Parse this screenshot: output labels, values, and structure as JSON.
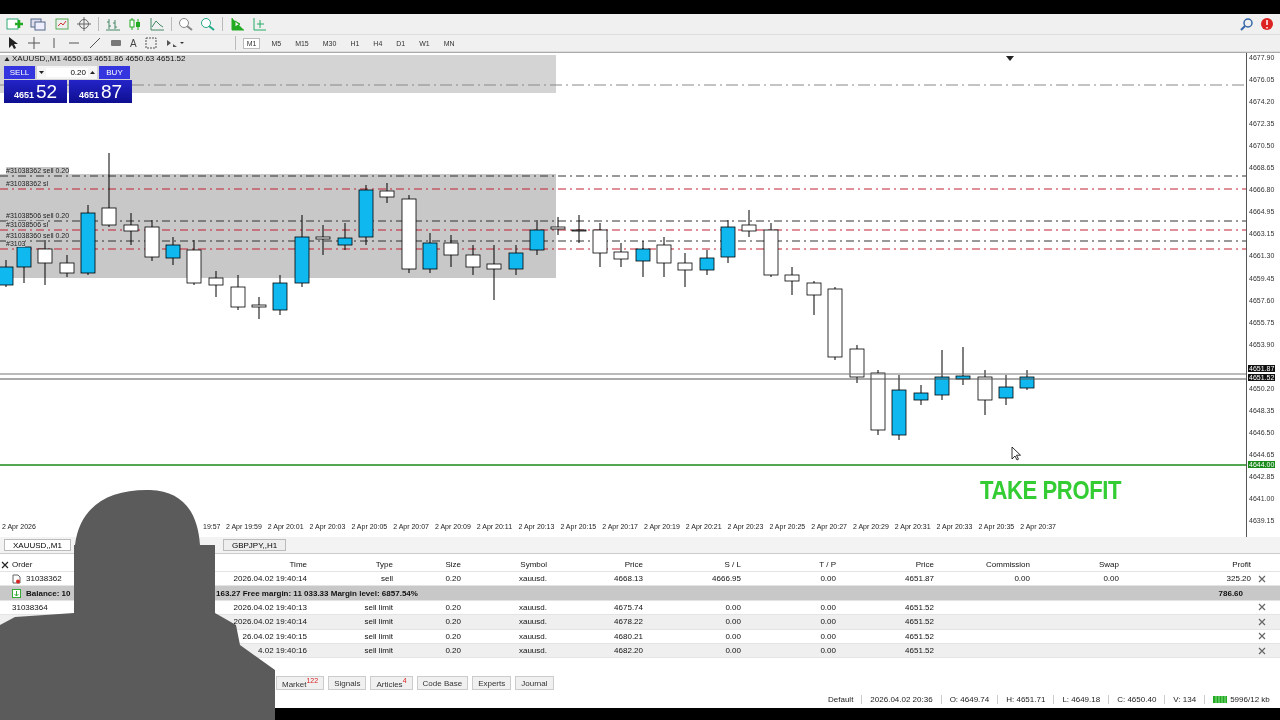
{
  "toolbar": {
    "text_tool": "A",
    "timeframes": [
      {
        "label": "M1",
        "selected": true
      },
      {
        "label": "M5",
        "selected": false
      },
      {
        "label": "M15",
        "selected": false
      },
      {
        "label": "M30",
        "selected": false
      },
      {
        "label": "H1",
        "selected": false
      },
      {
        "label": "H4",
        "selected": false
      },
      {
        "label": "D1",
        "selected": false
      },
      {
        "label": "W1",
        "selected": false
      },
      {
        "label": "MN",
        "selected": false
      }
    ]
  },
  "chart": {
    "header": "XAUUSD,,M1  4650.63 4651.86 4650.63 4651.52",
    "trade_panel": {
      "sell_label": "SELL",
      "volume": "0.20",
      "buy_label": "BUY",
      "bid_big": "4651",
      "bid_pips": "52",
      "ask_big": "4651",
      "ask_pips": "87"
    },
    "order_labels": [
      {
        "text": "#31038362 sell 0.20",
        "kind": "entry"
      },
      {
        "text": "#31038362 sl",
        "kind": "sl"
      },
      {
        "text": "#31038506 sell 0.20",
        "kind": "entry"
      },
      {
        "text": "#31038506 sl",
        "kind": "sl"
      },
      {
        "text": "#31038360 sell 0.20",
        "kind": "entry"
      },
      {
        "text": "#3103",
        "kind": "sl"
      }
    ],
    "price_axis": [
      "4677.90",
      "4676.05",
      "4674.20",
      "4672.35",
      "4670.50",
      "4668.65",
      "4666.80",
      "4664.95",
      "4663.15",
      "4661.30",
      "4659.45",
      "4657.60",
      "4655.75",
      "4653.90",
      "4650.20",
      "4648.35",
      "4646.50",
      "4644.65",
      "4642.85",
      "4641.00",
      "4639.15"
    ],
    "price_tags": [
      {
        "text": "4651.87",
        "kind": "ask"
      },
      {
        "text": "4651.52",
        "kind": "bid"
      },
      {
        "text": "4644.00",
        "kind": "tp"
      }
    ],
    "time_axis": [
      "2 Apr 2026",
      "19:57",
      "2 Apr 19:59",
      "2 Apr 20:01",
      "2 Apr 20:03",
      "2 Apr 20:05",
      "2 Apr 20:07",
      "2 Apr 20:09",
      "2 Apr 20:11",
      "2 Apr 20:13",
      "2 Apr 20:15",
      "2 Apr 20:17",
      "2 Apr 20:19",
      "2 Apr 20:21",
      "2 Apr 20:23",
      "2 Apr 20:25",
      "2 Apr 20:27",
      "2 Apr 20:29",
      "2 Apr 20:31",
      "2 Apr 20:33",
      "2 Apr 20:35",
      "2 Apr 20:37"
    ],
    "overlay_text": "TAKE PROFIT"
  },
  "chart_tabs": [
    {
      "label": "XAUUSD,,M1",
      "selected": true
    },
    {
      "label": "GBPJPY,,H1",
      "selected": false
    }
  ],
  "orders_table": {
    "columns": [
      "Order",
      "Time",
      "Type",
      "Size",
      "Symbol",
      "Price",
      "S / L",
      "T / P",
      "Price",
      "Commission",
      "Swap",
      "Profit"
    ],
    "rows": [
      {
        "kind": "position",
        "order": "31038362",
        "time": "2026.04.02 19:40:14",
        "type": "sell",
        "size": "0.20",
        "symbol": "xauusd.",
        "price": "4668.13",
        "sl": "4666.95",
        "tp": "0.00",
        "current": "4651.87",
        "commission": "0.00",
        "swap": "0.00",
        "profit": "325.20"
      },
      {
        "kind": "balance",
        "summary_start": "Balance: 10",
        "summary_end": "163.27  Free margin: 11 033.33  Margin level: 6857.54%",
        "profit": "786.60"
      },
      {
        "kind": "pending",
        "order": "31038364",
        "time": "2026.04.02 19:40:13",
        "type": "sell limit",
        "size": "0.20",
        "symbol": "xauusd.",
        "price": "4675.74",
        "sl": "0.00",
        "tp": "0.00",
        "current": "4651.52"
      },
      {
        "kind": "pending",
        "time": "2026.04.02 19:40:14",
        "type": "sell limit",
        "size": "0.20",
        "symbol": "xauusd.",
        "price": "4678.22",
        "sl": "0.00",
        "tp": "0.00",
        "current": "4651.52"
      },
      {
        "kind": "pending",
        "time": "26.04.02 19:40:15",
        "type": "sell limit",
        "size": "0.20",
        "symbol": "xauusd.",
        "price": "4680.21",
        "sl": "0.00",
        "tp": "0.00",
        "current": "4651.52"
      },
      {
        "kind": "pending",
        "time": "4.02 19:40:16",
        "type": "sell limit",
        "size": "0.20",
        "symbol": "xauusd.",
        "price": "4682.20",
        "sl": "0.00",
        "tp": "0.00",
        "current": "4651.52"
      }
    ]
  },
  "terminal_tabs": [
    {
      "label": "Market",
      "badge": "122"
    },
    {
      "label": "Signals"
    },
    {
      "label": "Articles",
      "badge": "4"
    },
    {
      "label": "Code Base"
    },
    {
      "label": "Experts"
    },
    {
      "label": "Journal"
    }
  ],
  "status_bar": [
    "Default",
    "2026.04.02 20:36",
    "O: 4649.74",
    "H: 4651.71",
    "L: 4649.18",
    "C: 4650.40",
    "V: 134",
    "5996/12 kb"
  ]
}
